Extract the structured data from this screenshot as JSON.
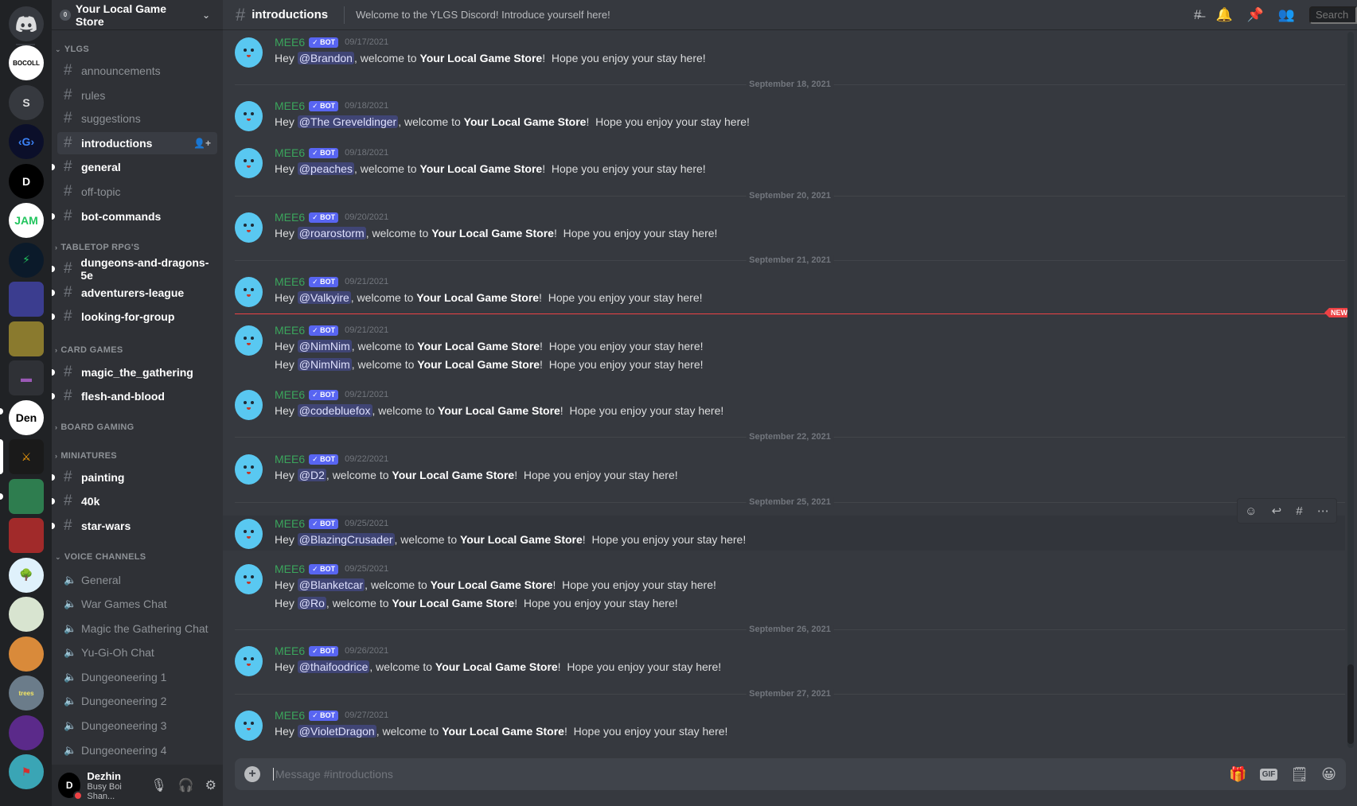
{
  "server_rail": {
    "home_icon": "discord-logo-icon",
    "servers": [
      {
        "name": "BOCOLL",
        "label": "BOCOLL",
        "color": "#ffffff",
        "text_color": "#000000"
      },
      {
        "name": "S",
        "label": "S",
        "color": "#36393f",
        "text_color": "#dcddde"
      },
      {
        "name": "G",
        "label": "‹G›",
        "color": "#0b0f2a",
        "text_color": "#3b82f6"
      },
      {
        "name": "D",
        "label": "D",
        "color": "#000000",
        "text_color": "#ffffff"
      },
      {
        "name": "JAM",
        "label": "JAM",
        "color": "#ffffff",
        "text_color": "#22c55e"
      },
      {
        "name": "bolt-server",
        "label": "⚡",
        "color": "#0b1a2a",
        "text_color": "#22c55e"
      },
      {
        "name": "folder-1",
        "label": "",
        "color": "#3b3d8f",
        "text_color": "#ffffff"
      },
      {
        "name": "folder-2",
        "label": "",
        "color": "#8a7a2e",
        "text_color": "#ffffff"
      },
      {
        "name": "folder-3",
        "label": "▬",
        "color": "#2f3136",
        "text_color": "#9b59b6"
      },
      {
        "name": "Den",
        "label": "Den",
        "color": "#ffffff",
        "text_color": "#000000"
      },
      {
        "name": "axe-server",
        "label": "⚔",
        "color": "#1a1a1a",
        "text_color": "#f59e0b"
      },
      {
        "name": "folder-4",
        "label": "",
        "color": "#2e7d4f",
        "text_color": "#ffffff"
      },
      {
        "name": "folder-5",
        "label": "",
        "color": "#a12a2a",
        "text_color": "#ffffff"
      },
      {
        "name": "tree-server",
        "label": "🌳",
        "color": "#dff1fb",
        "text_color": "#5a8a2a"
      },
      {
        "name": "pattern-server",
        "label": "",
        "color": "#d8e4d0",
        "text_color": "#2e7d4f"
      },
      {
        "name": "bottle-server",
        "label": "",
        "color": "#d98a3a",
        "text_color": "#ffffff"
      },
      {
        "name": "trees",
        "label": "trees",
        "color": "#6b7c8a",
        "text_color": "#f5e663"
      },
      {
        "name": "avatar-server",
        "label": "",
        "color": "#5b2a8a",
        "text_color": "#ffffff"
      },
      {
        "name": "flag-server",
        "label": "⚑",
        "color": "#3aa5b5",
        "text_color": "#d32f2f"
      }
    ]
  },
  "guild": {
    "name": "Your Local Game Store",
    "badge": "0"
  },
  "categories": [
    {
      "name": "YLGS",
      "channels": [
        {
          "name": "announcements",
          "state": "read"
        },
        {
          "name": "rules",
          "state": "read"
        },
        {
          "name": "suggestions",
          "state": "read"
        },
        {
          "name": "introductions",
          "state": "selected"
        },
        {
          "name": "general",
          "state": "unread"
        },
        {
          "name": "off-topic",
          "state": "read"
        },
        {
          "name": "bot-commands",
          "state": "unread"
        }
      ]
    },
    {
      "name": "TABLETOP RPG'S",
      "channels": [
        {
          "name": "dungeons-and-dragons-5e",
          "state": "unread"
        },
        {
          "name": "adventurers-league",
          "state": "unread"
        },
        {
          "name": "looking-for-group",
          "state": "unread"
        }
      ]
    },
    {
      "name": "CARD GAMES",
      "channels": [
        {
          "name": "magic_the_gathering",
          "state": "unread"
        },
        {
          "name": "flesh-and-blood",
          "state": "unread"
        }
      ]
    },
    {
      "name": "BOARD GAMING",
      "channels": []
    },
    {
      "name": "MINIATURES",
      "channels": [
        {
          "name": "painting",
          "state": "unread"
        },
        {
          "name": "40k",
          "state": "unread"
        },
        {
          "name": "star-wars",
          "state": "unread"
        }
      ]
    },
    {
      "name": "VOICE CHANNELS",
      "channels": [
        {
          "name": "General",
          "state": "voice"
        },
        {
          "name": "War Games Chat",
          "state": "voice"
        },
        {
          "name": "Magic the Gathering Chat",
          "state": "voice"
        },
        {
          "name": "Yu-Gi-Oh Chat",
          "state": "voice"
        },
        {
          "name": "Dungeoneering 1",
          "state": "voice"
        },
        {
          "name": "Dungeoneering 2",
          "state": "voice"
        },
        {
          "name": "Dungeoneering 3",
          "state": "voice"
        },
        {
          "name": "Dungeoneering 4",
          "state": "voice"
        }
      ]
    }
  ],
  "user_panel": {
    "name": "Dezhin",
    "status_text": "Busy Boi Shan...",
    "status": "dnd"
  },
  "channel_header": {
    "name": "introductions",
    "topic": "Welcome to the YLGS Discord! Introduce yourself here!",
    "search_placeholder": "Search"
  },
  "messages": [
    {
      "type": "message",
      "author": "MEE6",
      "bot_tag": "✓ BOT",
      "timestamp": "09/17/2021",
      "lines": [
        "Brandon"
      ]
    },
    {
      "type": "divider",
      "label": "September 18, 2021"
    },
    {
      "type": "message",
      "author": "MEE6",
      "bot_tag": "✓ BOT",
      "timestamp": "09/18/2021",
      "lines": [
        "The Greveldinger"
      ]
    },
    {
      "type": "message",
      "author": "MEE6",
      "bot_tag": "✓ BOT",
      "timestamp": "09/18/2021",
      "lines": [
        "peaches"
      ]
    },
    {
      "type": "divider",
      "label": "September 20, 2021"
    },
    {
      "type": "message",
      "author": "MEE6",
      "bot_tag": "✓ BOT",
      "timestamp": "09/20/2021",
      "lines": [
        "roarostorm"
      ]
    },
    {
      "type": "divider",
      "label": "September 21, 2021"
    },
    {
      "type": "message",
      "author": "MEE6",
      "bot_tag": "✓ BOT",
      "timestamp": "09/21/2021",
      "lines": [
        "Valkyire"
      ]
    },
    {
      "type": "new",
      "label": "NEW"
    },
    {
      "type": "message",
      "author": "MEE6",
      "bot_tag": "✓ BOT",
      "timestamp": "09/21/2021",
      "lines": [
        "NimNim",
        "NimNim"
      ]
    },
    {
      "type": "message",
      "author": "MEE6",
      "bot_tag": "✓ BOT",
      "timestamp": "09/21/2021",
      "lines": [
        "codebluefox"
      ]
    },
    {
      "type": "divider",
      "label": "September 22, 2021"
    },
    {
      "type": "message",
      "author": "MEE6",
      "bot_tag": "✓ BOT",
      "timestamp": "09/22/2021",
      "lines": [
        "D2"
      ]
    },
    {
      "type": "divider",
      "label": "September 25, 2021"
    },
    {
      "type": "message",
      "author": "MEE6",
      "bot_tag": "✓ BOT",
      "timestamp": "09/25/2021",
      "lines": [
        "BlazingCrusader"
      ],
      "hovered": true
    },
    {
      "type": "message",
      "author": "MEE6",
      "bot_tag": "✓ BOT",
      "timestamp": "09/25/2021",
      "lines": [
        "Blanketcar",
        "Ro"
      ]
    },
    {
      "type": "divider",
      "label": "September 26, 2021"
    },
    {
      "type": "message",
      "author": "MEE6",
      "bot_tag": "✓ BOT",
      "timestamp": "09/26/2021",
      "lines": [
        "thaifoodrice"
      ]
    },
    {
      "type": "divider",
      "label": "September 27, 2021"
    },
    {
      "type": "message",
      "author": "MEE6",
      "bot_tag": "✓ BOT",
      "timestamp": "09/27/2021",
      "lines": [
        "VioletDragon"
      ]
    }
  ],
  "welcome_template": {
    "prefix": "Hey ",
    "middle": ", welcome to ",
    "store": "Your Local Game Store",
    "suffix": "!  Hope you enjoy your stay here!"
  },
  "message_actions": [
    "add-reaction-icon",
    "reply-icon",
    "create-thread-icon",
    "more-icon"
  ],
  "composer": {
    "placeholder": "Message #introductions",
    "gif_label": "GIF"
  },
  "colors": {
    "accent": "#5865f2",
    "bot_author": "#3ba55c",
    "new_marker": "#ed4245"
  }
}
